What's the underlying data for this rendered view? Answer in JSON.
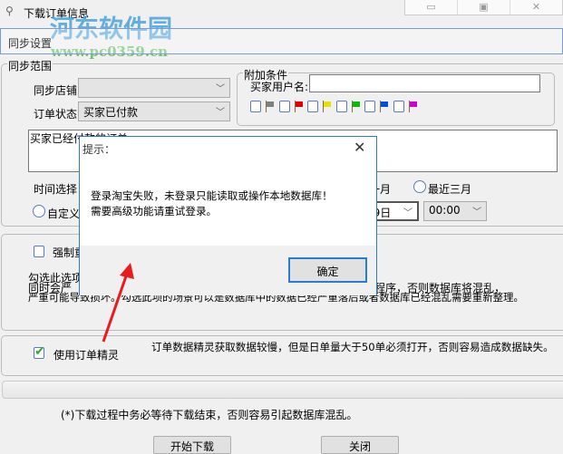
{
  "window": {
    "title": "下载订单信息",
    "min_icon": "minimize-icon",
    "max_icon": "maximize-icon",
    "close_icon": "close-icon"
  },
  "watermark": {
    "name": "河东软件园",
    "url": "www.pc0359.cn"
  },
  "tab": {
    "label": "同步设置"
  },
  "sync_range": {
    "label": "同步范围",
    "shop_label": "同步店铺:",
    "shop_value": "",
    "status_label": "订单状态:",
    "status_value": "买家已付款",
    "description": "买家已经付款的订单。",
    "time_label": "时间选择",
    "partial_month": "一月",
    "radio_last3": "最近三月",
    "radio_custom": "自定义",
    "date_value": "月29日",
    "time_value": "00:00"
  },
  "extra": {
    "label": "附加条件",
    "buyer_label": "买家用户名:",
    "buyer_value": "",
    "flags": [
      "#808080",
      "#e00000",
      "#e8e000",
      "#00c000",
      "#0050e0",
      "#d000d0"
    ]
  },
  "force": {
    "label": "强制重",
    "line1": "勾选此选项",
    "line2a": "同时会严",
    "line2b": "程序，否则数据库将混乱，",
    "line3": "严重可能导致损坏。勾选此项的场景可以是数据库中的数据已经严重落后或者数据库已经混乱需要重新整理。"
  },
  "wizard": {
    "label": "使用订单精灵",
    "checked": true,
    "note": "订单数据精灵获取数据较慢，但是日单量大于50单必须打开，否则容易造成数据缺失。"
  },
  "footer": {
    "note": "(*)下载过程中务必等待下载结束，否则容易引起数据库混乱。",
    "start": "开始下载",
    "close": "关闭"
  },
  "dialog": {
    "title": "提示：",
    "line1": "登录淘宝失败，未登录只能读取或操作本地数据库！",
    "line2": "需要高级功能请重试登录。",
    "ok": "确定"
  }
}
